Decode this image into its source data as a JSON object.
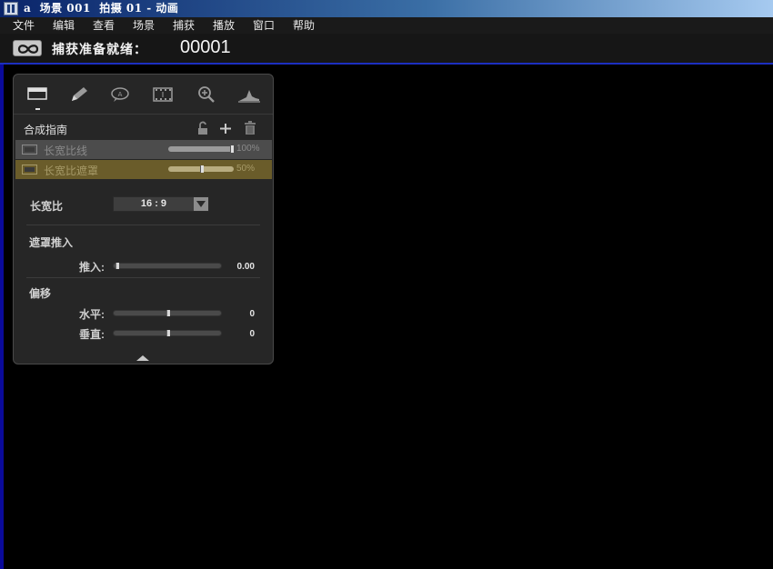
{
  "window": {
    "title": "a  场景 001  拍摄 01 - 动画"
  },
  "menu": [
    {
      "label": "文件"
    },
    {
      "label": "编辑"
    },
    {
      "label": "查看"
    },
    {
      "label": "场景"
    },
    {
      "label": "捕获"
    },
    {
      "label": "播放"
    },
    {
      "label": "窗口"
    },
    {
      "label": "帮助"
    }
  ],
  "status": {
    "label": "捕获准备就绪：",
    "frame": "00001"
  },
  "panel": {
    "header": "合成指南",
    "rows": [
      {
        "label": "长宽比线",
        "value": "100%",
        "level": 1.0
      },
      {
        "label": "长宽比遮罩",
        "value": "50%",
        "level": 0.5
      }
    ],
    "aspect": {
      "label": "长宽比",
      "value": "16 : 9"
    },
    "mask_push": {
      "title": "遮罩推入",
      "push_label": "推入:",
      "push_value": "0.00",
      "push_level": 0.0
    },
    "offset": {
      "title": "偏移",
      "h_label": "水平:",
      "h_value": "0",
      "h_level": 0.5,
      "v_label": "垂直:",
      "v_value": "0",
      "v_level": 0.5
    }
  },
  "colors": {
    "titlebar_start": "#0a246a",
    "titlebar_end": "#a6caf0",
    "accent_blue": "#1c2fbf",
    "mask_row": "#6a5c2a",
    "panel_bg": "#262626"
  }
}
